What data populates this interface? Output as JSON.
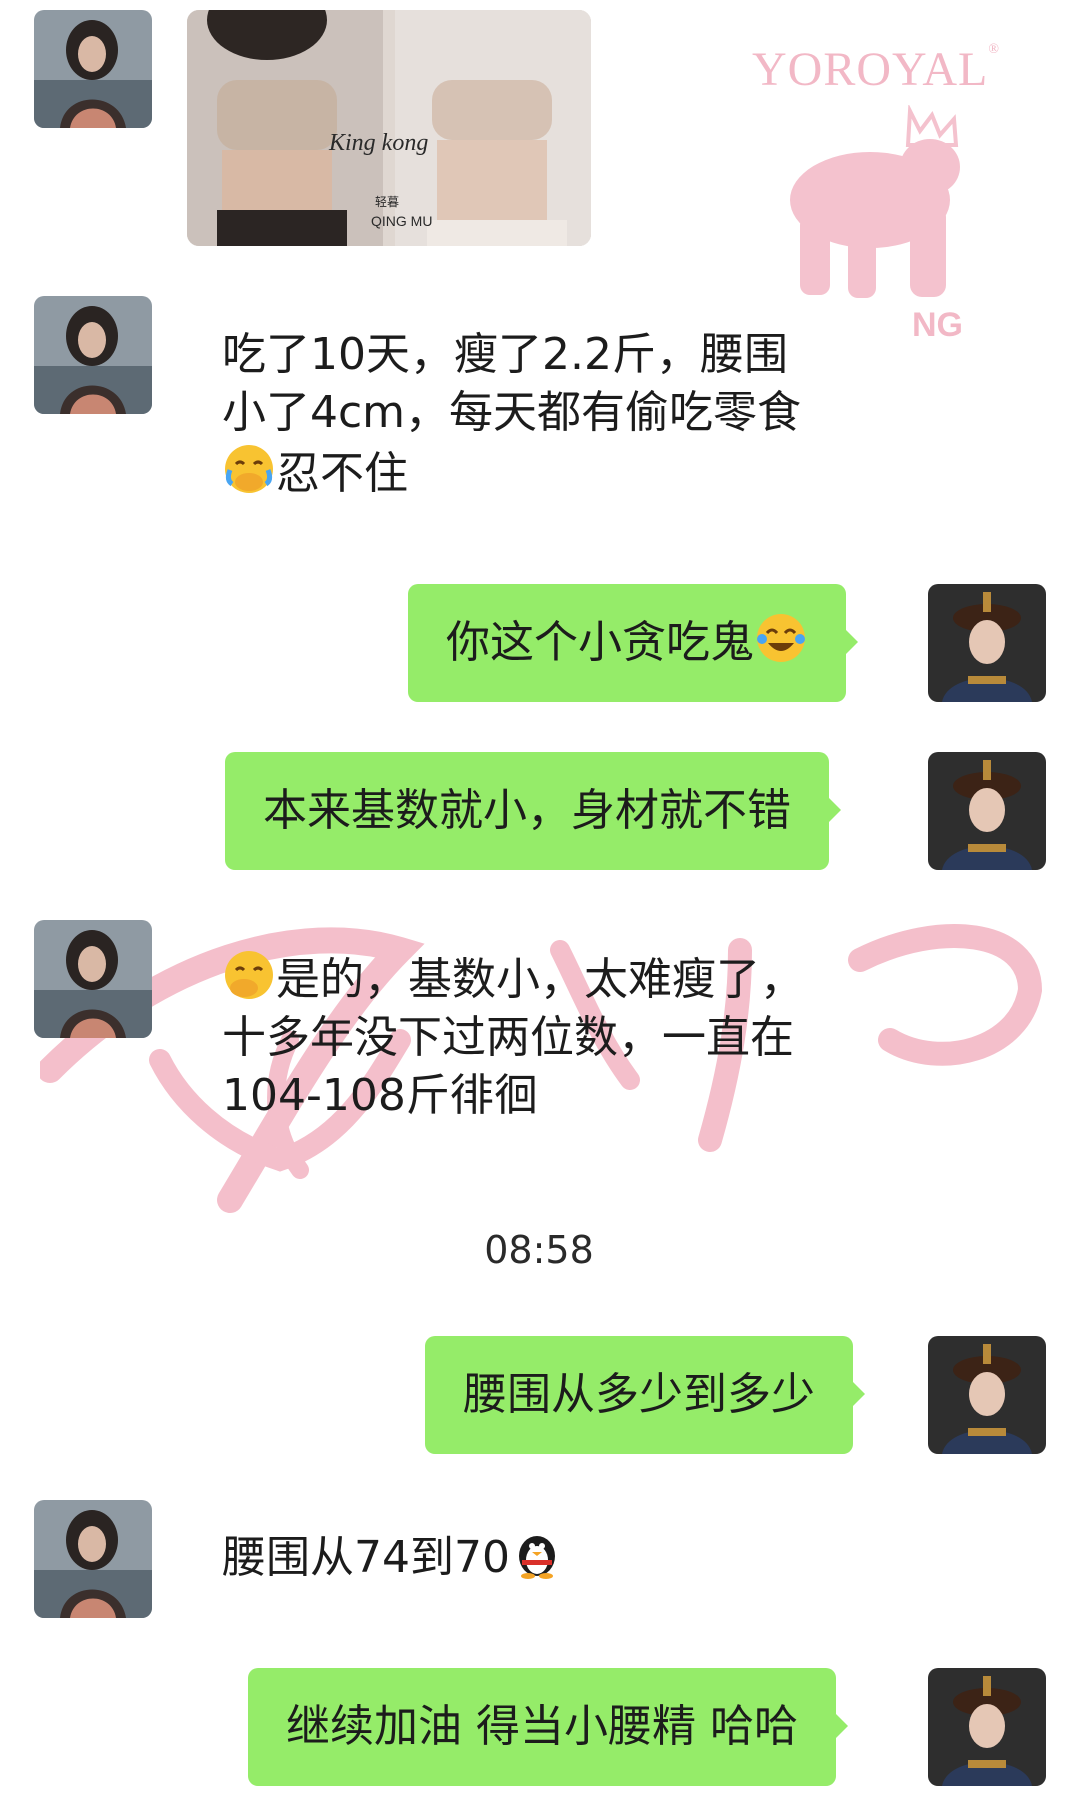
{
  "watermark": {
    "brand": "YOROYAL",
    "brand_mark": "®",
    "fragment": "NG",
    "color": "#f2b8c6"
  },
  "photo_message": {
    "overlay_text_1": "King kong",
    "overlay_text_2": "轻暮",
    "overlay_text_3": "QING MU"
  },
  "messages": [
    {
      "side": "in",
      "lines": [
        "吃了10天，瘦了2.2斤，腰围",
        "小了4cm，每天都有偷吃零食",
        "忍不住"
      ],
      "emoji": "face-hand-over-mouth-tears"
    },
    {
      "side": "out",
      "text": "你这个小贪吃鬼",
      "emoji": "tears-of-joy"
    },
    {
      "side": "out",
      "text": "本来基数就小，身材就不错"
    },
    {
      "side": "in",
      "lines": [
        "是的，基数小，太难瘦了，",
        "十多年没下过两位数，一直在",
        "104-108斤徘徊"
      ],
      "emoji": "face-hand-over-mouth"
    },
    {
      "side": "out",
      "text": "腰围从多少到多少"
    },
    {
      "side": "in",
      "lines": [
        "腰围从74到70"
      ],
      "emoji": "penguin"
    },
    {
      "side": "out",
      "text": "继续加油 得当小腰精 哈哈"
    }
  ],
  "timestamp": "08:58",
  "colors": {
    "bubble_out": "#95ec69",
    "background": "#ffffff",
    "text": "#1c1c1c"
  }
}
